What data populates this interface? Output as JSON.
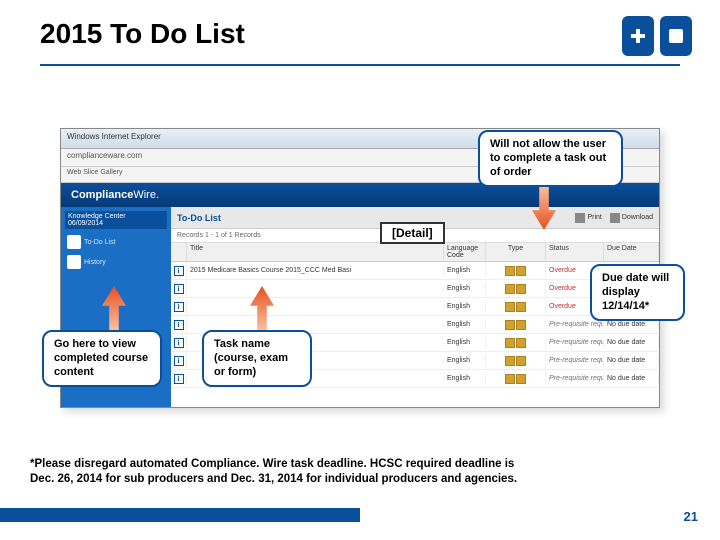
{
  "slide": {
    "title": "2015 To Do List",
    "page_number": "21"
  },
  "logos": {
    "cross": "cross",
    "shield": "shield"
  },
  "browser": {
    "title": "Windows Internet Explorer",
    "url": "complianceware.com",
    "tabs_label": "Web Slice Gallery"
  },
  "app": {
    "brand": "Compliance",
    "brand_suffix": "Wire.",
    "sidebar": {
      "title": "Knowledge Center",
      "date": "06/09/2014",
      "items": [
        {
          "label": "To-Do List"
        },
        {
          "label": "History"
        }
      ]
    },
    "main": {
      "header_title": "To-Do List",
      "list_meta": "Records 1 - 1 of 1 Records",
      "detail_link": "[Detail]",
      "print_link": "Print",
      "download_link": "Download",
      "columns": {
        "type": "Type",
        "title": "Title",
        "lang": "Language Code",
        "item_type": "Type",
        "status": "Status",
        "due": "Due Date"
      },
      "sample_title": "2015 Medicare Basics Course",
      "sample_code": "2015_CCC Med Basi",
      "rows": [
        {
          "lang": "English",
          "status": "Overdue",
          "status_class": "red",
          "due": ""
        },
        {
          "lang": "English",
          "status": "Overdue",
          "status_class": "red",
          "due": ""
        },
        {
          "lang": "English",
          "status": "Overdue",
          "status_class": "red",
          "due": ""
        },
        {
          "lang": "English",
          "status": "Pre-requisite required",
          "status_class": "gray",
          "due": "No due date"
        },
        {
          "lang": "English",
          "status": "Pre-requisite required",
          "status_class": "gray",
          "due": "No due date"
        },
        {
          "lang": "English",
          "status": "Pre-requisite required",
          "status_class": "gray",
          "due": "No due date"
        },
        {
          "lang": "English",
          "status": "Pre-requisite required",
          "status_class": "gray",
          "due": "No due date"
        }
      ]
    }
  },
  "callouts": {
    "top_right": "Will not allow the user to complete a task out of order",
    "right": "Due date will display 12/14/14*",
    "bottom_left": "Go here to view completed course content",
    "bottom_mid": "Task name (course, exam or form)",
    "detail_label": "[Detail]"
  },
  "footnote": {
    "line1_a": "*Please disregard automated Compliance",
    "line1_b": "Wire task deadline. HCSC required deadline is",
    "line2_a": "Dec. 26, 2014",
    "line2_b": " for sub producers and ",
    "line2_c": "Dec. 31, 2014",
    "line2_d": " for individual producers and agencies."
  }
}
